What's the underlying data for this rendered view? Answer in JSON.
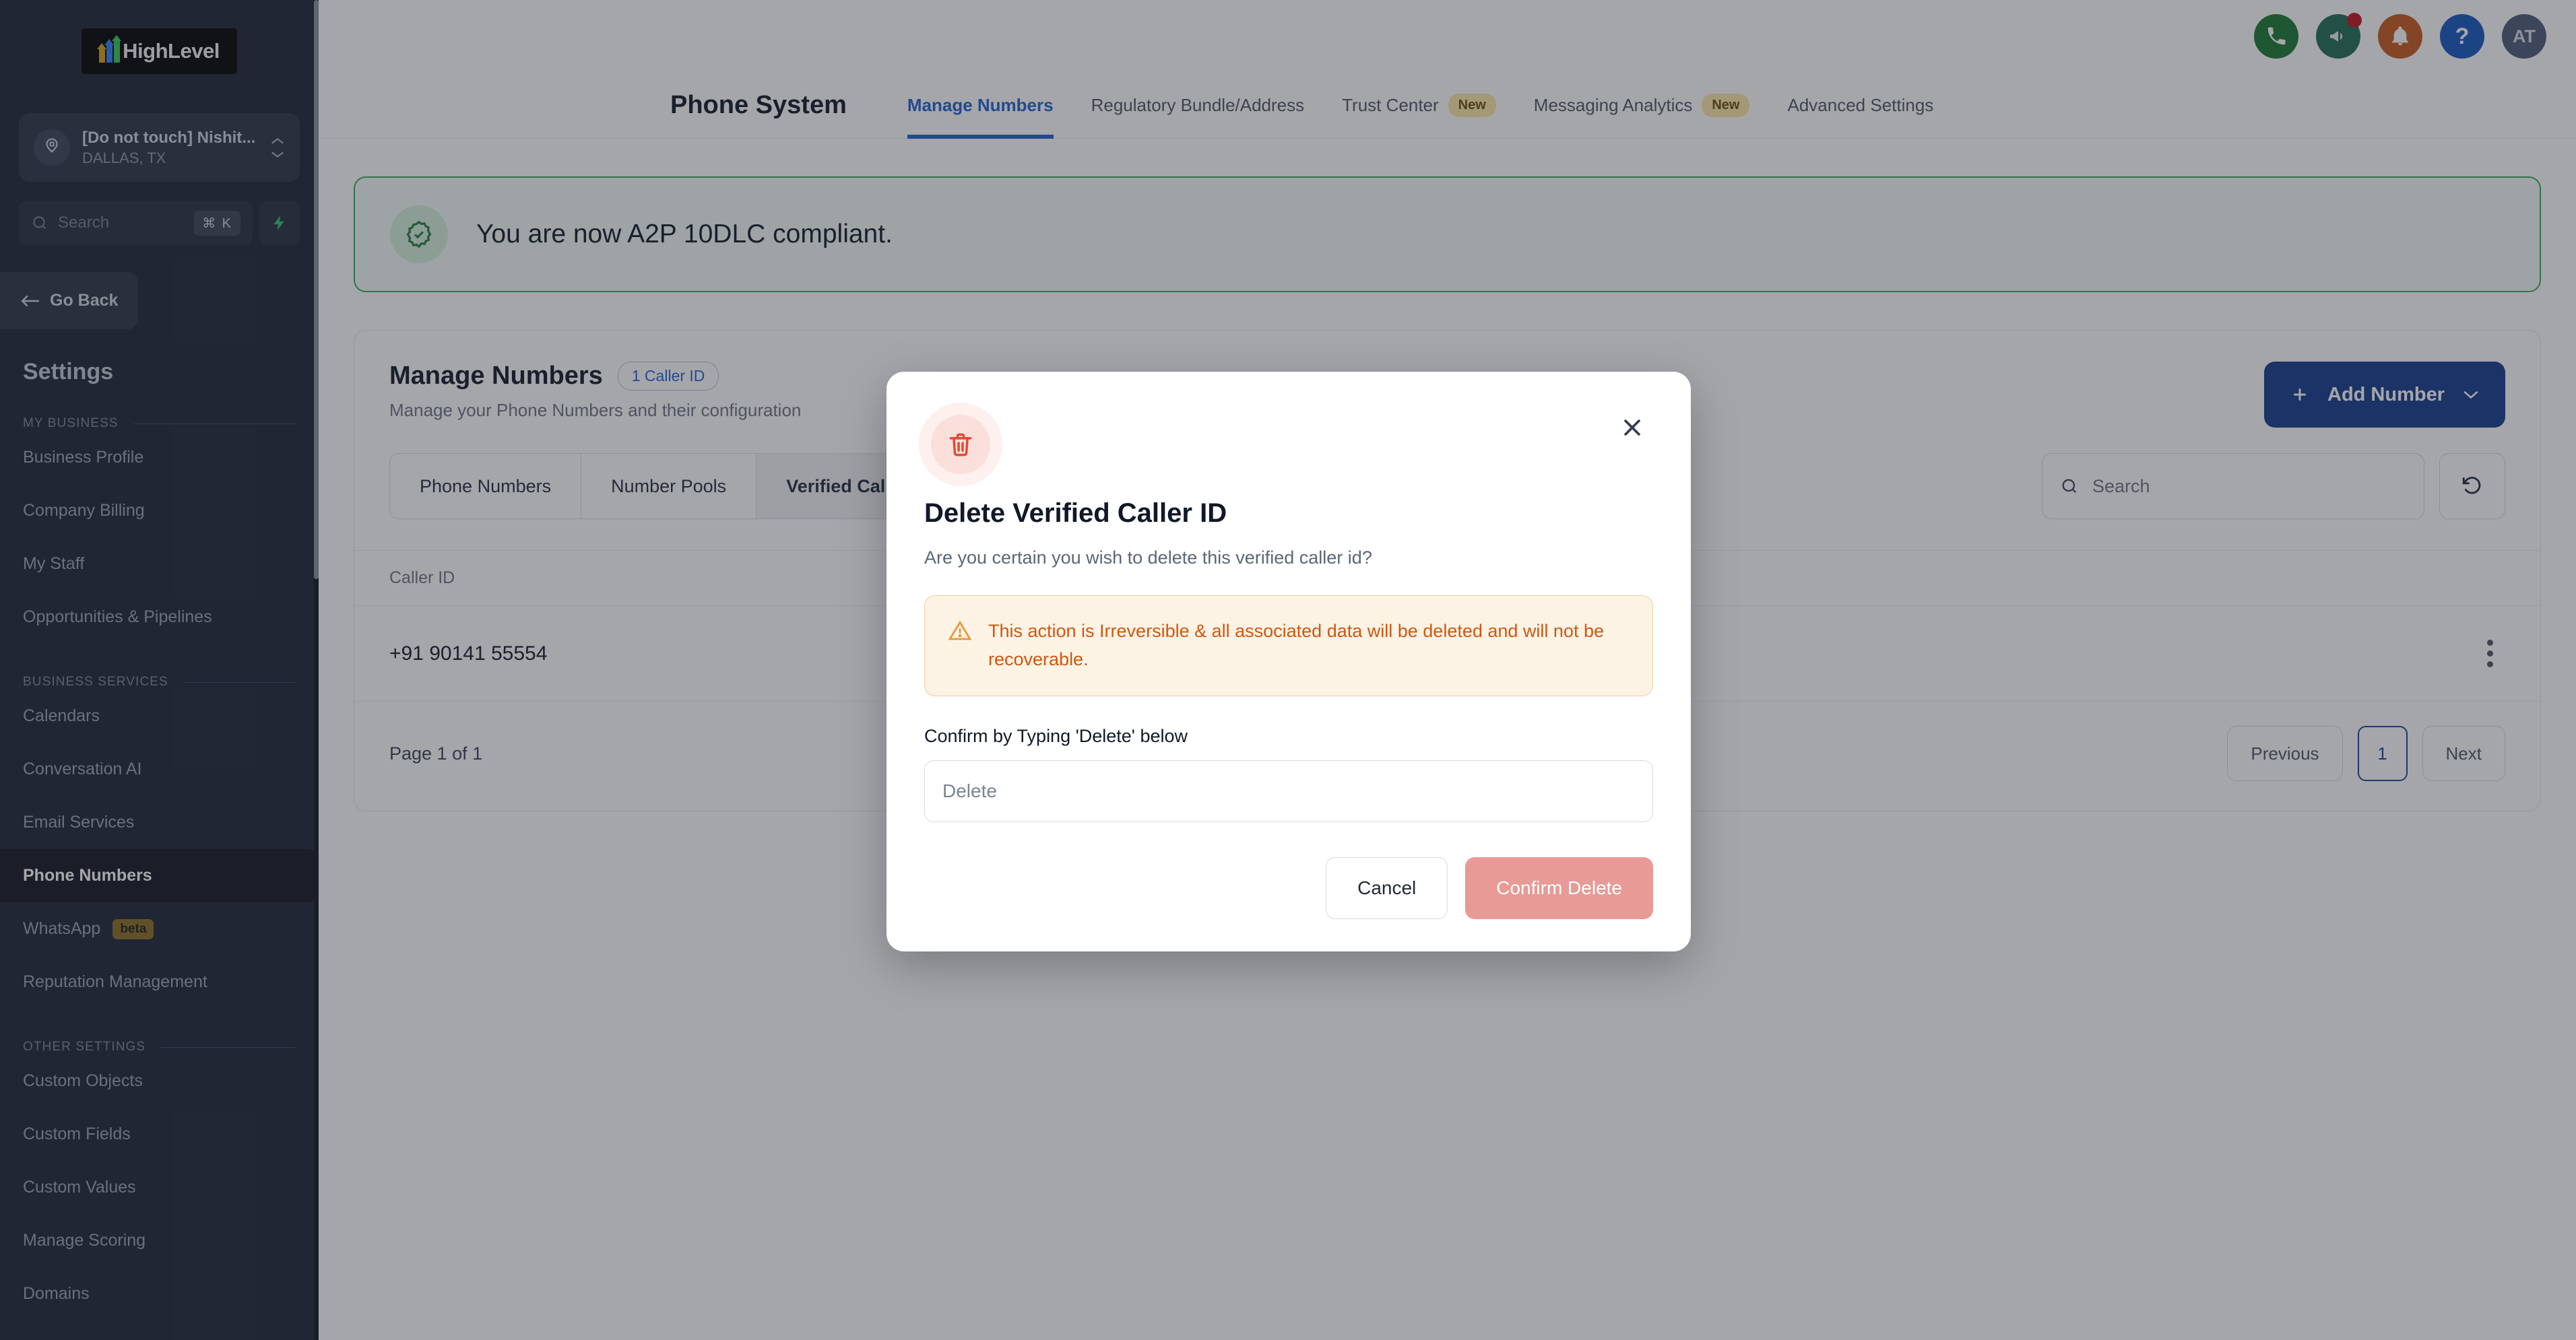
{
  "brand": {
    "name": "HighLevel"
  },
  "sidebar": {
    "location": {
      "name": "[Do not touch] Nishit...",
      "sub": "DALLAS, TX"
    },
    "search": {
      "placeholder": "Search",
      "shortcut": "⌘ K"
    },
    "go_back": "Go Back",
    "title": "Settings",
    "sections": [
      {
        "label": "MY BUSINESS",
        "items": [
          {
            "label": "Business Profile",
            "active": false
          },
          {
            "label": "Company Billing",
            "active": false
          },
          {
            "label": "My Staff",
            "active": false
          },
          {
            "label": "Opportunities & Pipelines",
            "active": false
          }
        ]
      },
      {
        "label": "BUSINESS SERVICES",
        "items": [
          {
            "label": "Calendars",
            "active": false
          },
          {
            "label": "Conversation AI",
            "active": false
          },
          {
            "label": "Email Services",
            "active": false
          },
          {
            "label": "Phone Numbers",
            "active": true
          },
          {
            "label": "WhatsApp",
            "badge": "beta",
            "active": false
          },
          {
            "label": "Reputation Management",
            "active": false
          }
        ]
      },
      {
        "label": "OTHER SETTINGS",
        "items": [
          {
            "label": "Custom Objects",
            "active": false
          },
          {
            "label": "Custom Fields",
            "active": false
          },
          {
            "label": "Custom Values",
            "active": false
          },
          {
            "label": "Manage Scoring",
            "active": false
          },
          {
            "label": "Domains",
            "active": false
          }
        ]
      }
    ]
  },
  "topbar": {
    "icons": [
      "phone-icon",
      "megaphone-icon",
      "bell-icon",
      "help-icon"
    ],
    "avatar_initials": "AT"
  },
  "nav": {
    "page_title": "Phone System",
    "tabs": [
      {
        "label": "Manage Numbers",
        "badge": "",
        "active": true
      },
      {
        "label": "Regulatory Bundle/Address",
        "badge": "",
        "active": false
      },
      {
        "label": "Trust Center",
        "badge": "New",
        "active": false
      },
      {
        "label": "Messaging Analytics",
        "badge": "New",
        "active": false
      },
      {
        "label": "Advanced Settings",
        "badge": "",
        "active": false
      }
    ]
  },
  "banner": {
    "text": "You are now A2P 10DLC compliant."
  },
  "manage": {
    "title": "Manage Numbers",
    "chip": "1 Caller ID",
    "subtitle": "Manage your Phone Numbers and their configuration",
    "add_button": "Add Number",
    "segments": [
      {
        "label": "Phone Numbers",
        "selected": false
      },
      {
        "label": "Number Pools",
        "selected": false
      },
      {
        "label": "Verified Caller IDs",
        "selected": true
      }
    ],
    "search_placeholder": "Search",
    "table": {
      "columns": [
        "Caller ID"
      ],
      "rows": [
        {
          "caller_id": "+91 90141 55554"
        }
      ]
    },
    "pagination": {
      "page_text": "Page 1 of 1",
      "previous": "Previous",
      "current": "1",
      "next": "Next"
    }
  },
  "modal": {
    "title": "Delete Verified Caller ID",
    "subtitle": "Are you certain you wish to delete this verified caller id?",
    "warning": "This action is Irreversible & all associated data will be deleted and will not be recoverable.",
    "confirm_label": "Confirm by Typing 'Delete' below",
    "input_placeholder": "Delete",
    "input_value": "",
    "cancel": "Cancel",
    "confirm": "Confirm Delete"
  },
  "colors": {
    "accent_blue": "#1e5fd1",
    "primary_blue": "#123a8a",
    "danger_red": "#e04a34",
    "warn_orange": "#d1560f",
    "success_green": "#3ba55d",
    "delete_btn": "#e89a96"
  }
}
